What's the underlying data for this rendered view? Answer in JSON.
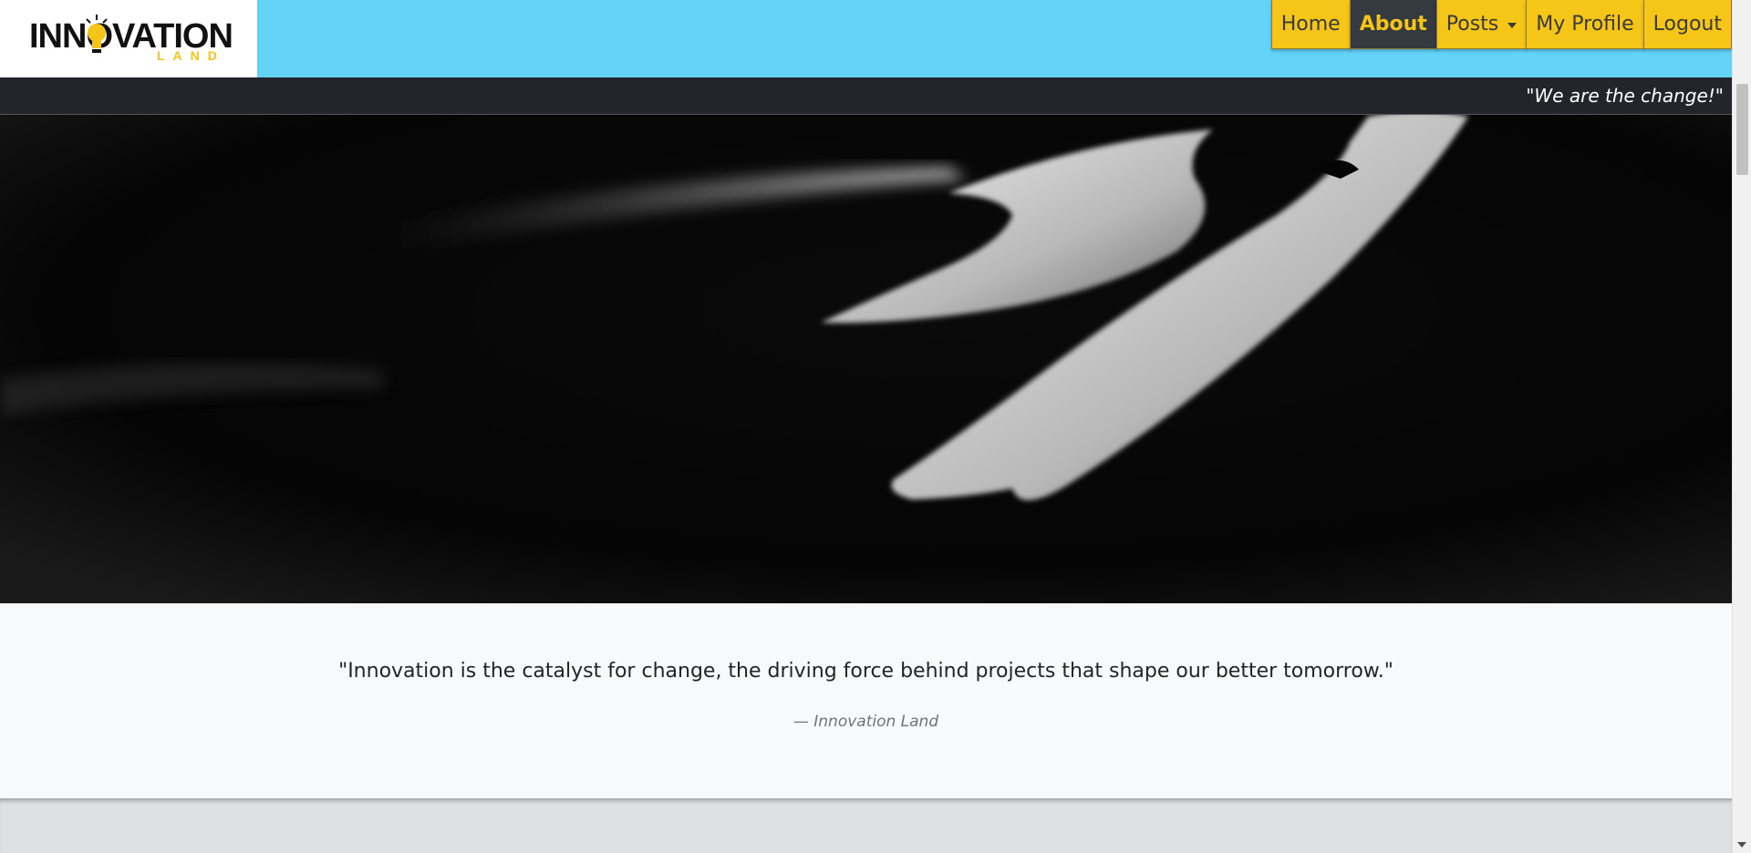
{
  "brand": {
    "logo_text": "INNOVATION",
    "logo_subtext": "LAND"
  },
  "nav": {
    "items": [
      {
        "label": "Home"
      },
      {
        "label": "About"
      },
      {
        "label": "Posts"
      },
      {
        "label": "My Profile"
      },
      {
        "label": "Logout"
      }
    ]
  },
  "tagline": "\"We are the change!\"",
  "quote": {
    "text": "\"Innovation is the catalyst for change, the driving force behind projects that shape our better tomorrow.\"",
    "attribution": "— Innovation Land"
  },
  "colors": {
    "header_bg": "#63d3f8",
    "nav_bg": "#f5c518",
    "nav_active_bg": "#343a40",
    "tagbar_bg": "#22262c"
  },
  "icons": {
    "logo_bulb": "lightbulb-icon",
    "posts_dropdown": "caret-down-icon"
  }
}
